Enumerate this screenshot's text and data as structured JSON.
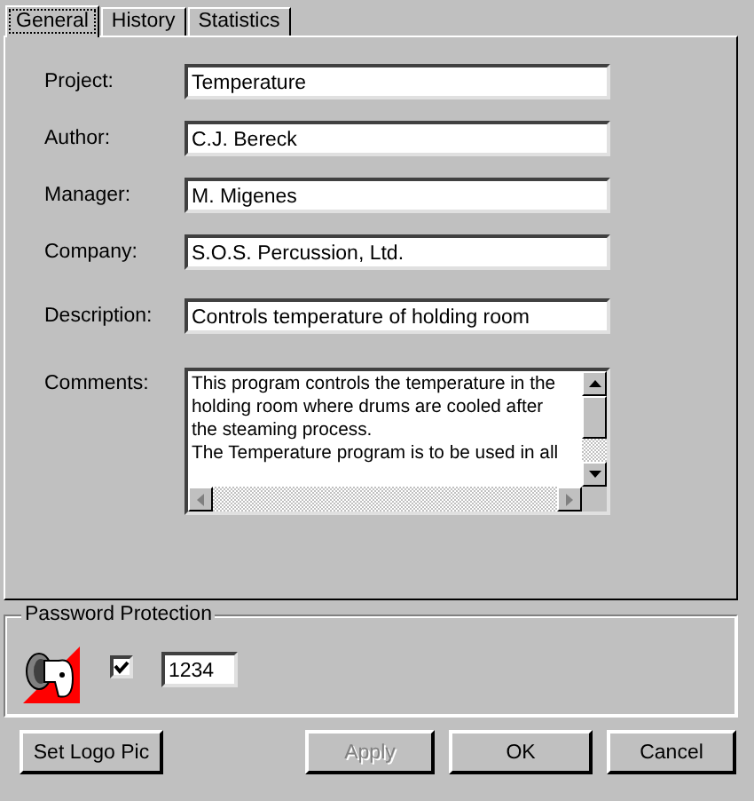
{
  "tabs": [
    {
      "label": "General",
      "selected": true
    },
    {
      "label": "History",
      "selected": false
    },
    {
      "label": "Statistics",
      "selected": false
    }
  ],
  "fields": [
    {
      "label": "Project:",
      "value": "Temperature"
    },
    {
      "label": "Author:",
      "value": "C.J. Bereck"
    },
    {
      "label": "Manager:",
      "value": "M. Migenes"
    },
    {
      "label": "Company:",
      "value": "S.O.S. Percussion, Ltd."
    },
    {
      "label": "Description:",
      "value": "Controls temperature of holding room"
    }
  ],
  "comments": {
    "label": "Comments:",
    "value": "This program controls the temperature in the\nholding room where drums are cooled after\nthe steaming process.\nThe Temperature program is to be used in all"
  },
  "password": {
    "title": "Password Protection",
    "checked": true,
    "value": "1234"
  },
  "buttons": [
    {
      "label": "Set Logo Pic",
      "disabled": false
    },
    {
      "label": "Apply",
      "disabled": true
    },
    {
      "label": "OK",
      "disabled": false
    },
    {
      "label": "Cancel",
      "disabled": false
    }
  ]
}
